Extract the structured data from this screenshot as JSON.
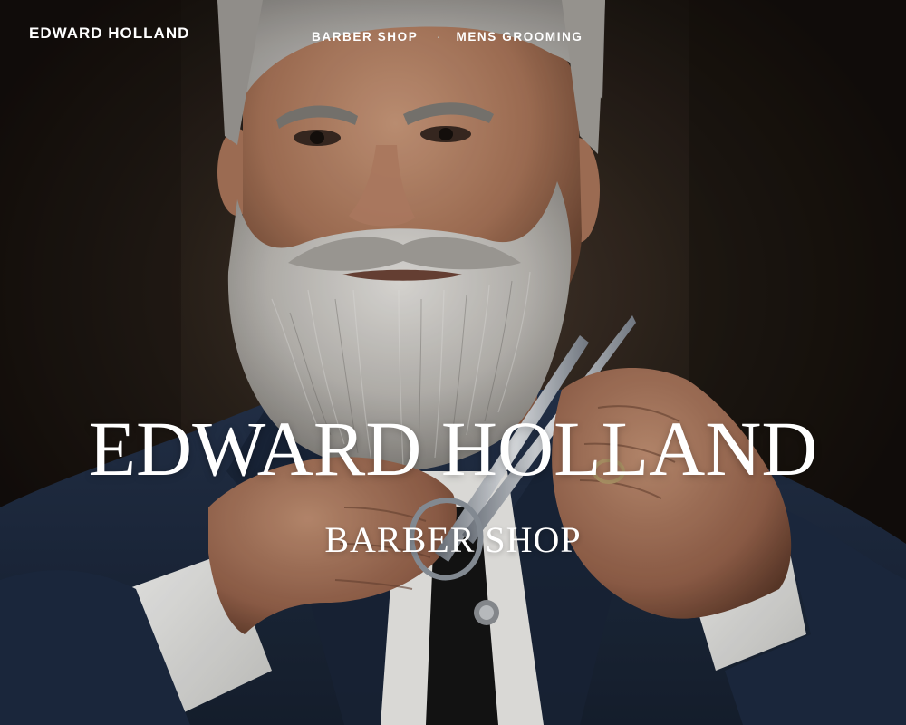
{
  "header": {
    "brand": "EDWARD HOLLAND",
    "nav": {
      "items": [
        {
          "label": "BARBER SHOP"
        },
        {
          "label": "MENS GROOMING"
        }
      ],
      "separator": "·"
    }
  },
  "hero": {
    "title": "EDWARD HOLLAND",
    "subtitle": "BARBER SHOP",
    "image_subject": "man with grey beard trimming beard with scissors"
  },
  "colors": {
    "text": "#ffffff",
    "background": "#1a1510",
    "suit": "#1f2d44",
    "beard": "#d2d0cc",
    "skin": "#b88a6c"
  }
}
